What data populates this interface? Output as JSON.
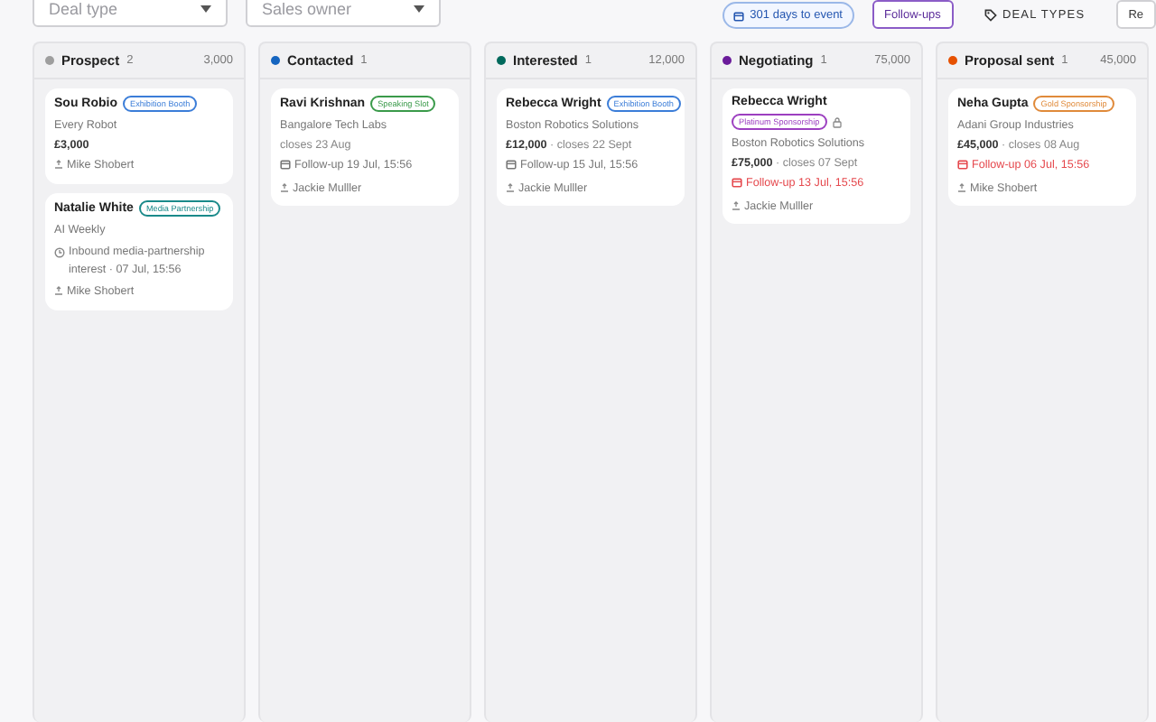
{
  "filters": [
    {
      "placeholder": "Deal type"
    },
    {
      "placeholder": "Sales owner"
    }
  ],
  "toolbar": {
    "event_countdown": "301 days to event",
    "followups_button": "Follow-ups",
    "deal_types_button": "DEAL TYPES",
    "cut_button": "Re"
  },
  "columns": [
    {
      "title": "Prospect",
      "count": "2",
      "total": "3,000",
      "color": "#9e9e9e",
      "cards": [
        {
          "name": "Sou Robio",
          "tag": {
            "label": "Exhibition Booth",
            "color": "#3b7dd8"
          },
          "company": "Every Robot",
          "value": "**£3,000**",
          "owner": "Mike Shobert"
        },
        {
          "name": "Natalie White",
          "tag": {
            "label": "Media Partnership",
            "color": "#1a8a8a"
          },
          "company": "AI Weekly",
          "activity": "Inbound media-partnership interest · 07 Jul, 15:56",
          "owner": "Mike Shobert"
        }
      ]
    },
    {
      "title": "Contacted",
      "count": "1",
      "color": "#1565c0",
      "cards": [
        {
          "name": "Ravi Krishnan",
          "tag": {
            "label": "Speaking Slot",
            "color": "#3a9a4a"
          },
          "company": "Bangalore Tech Labs",
          "value": "closes 23 Aug",
          "followup": {
            "text": "Follow-up 19 Jul, 15:56",
            "overdue": false
          },
          "owner": "Jackie Mulller"
        }
      ]
    },
    {
      "title": "Interested",
      "count": "1",
      "total": "12,000",
      "color": "#00695c",
      "cards": [
        {
          "name": "Rebecca Wright",
          "tag": {
            "label": "Exhibition Booth",
            "color": "#3b7dd8"
          },
          "company": "Boston Robotics Solutions",
          "value": "**£12,000** · closes 22 Sept",
          "followup": {
            "text": "Follow-up 15 Jul, 15:56",
            "overdue": false
          },
          "owner": "Jackie Mulller"
        }
      ]
    },
    {
      "title": "Negotiating",
      "count": "1",
      "total": "75,000",
      "color": "#6a1b9a",
      "cards": [
        {
          "name": "Rebecca Wright",
          "tag": {
            "label": "Platinum Sponsorship",
            "color": "#9c3fc0"
          },
          "tag_below": true,
          "locked": true,
          "company": "Boston Robotics Solutions",
          "value": "**£75,000** · closes 07 Sept",
          "followup": {
            "text": "Follow-up 13 Jul, 15:56",
            "overdue": true
          },
          "owner": "Jackie Mulller"
        }
      ]
    },
    {
      "title": "Proposal sent",
      "count": "1",
      "total": "45,000",
      "color": "#e65100",
      "cards": [
        {
          "name": "Neha Gupta",
          "tag": {
            "label": "Gold Sponsorship",
            "color": "#e08a3a"
          },
          "company": "Adani Group Industries",
          "value": "**£45,000** · closes 08 Aug",
          "followup": {
            "text": "Follow-up 06 Jul, 15:56",
            "overdue": true
          },
          "owner": "Mike Shobert"
        }
      ]
    }
  ]
}
